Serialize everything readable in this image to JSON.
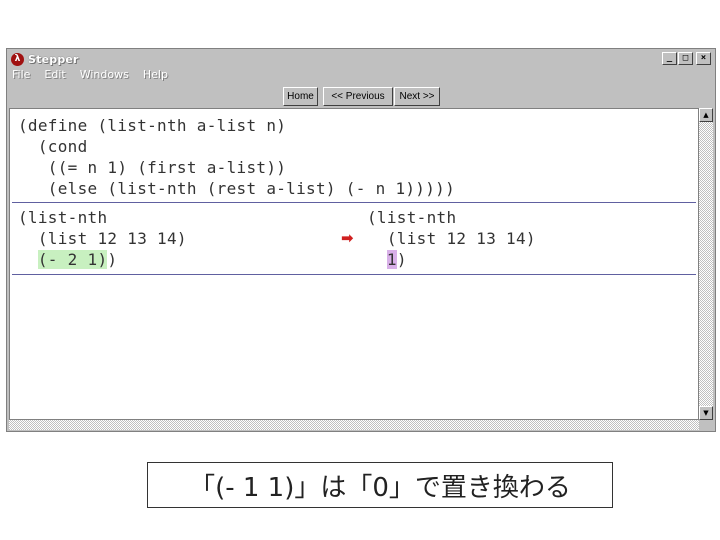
{
  "window": {
    "title": "Stepper",
    "app_icon_glyph": "λ",
    "controls": {
      "minimize": "_",
      "maximize": "□",
      "close": "×"
    }
  },
  "menu": [
    "File",
    "Edit",
    "Windows",
    "Help"
  ],
  "toolbar": {
    "home_label": "Home",
    "previous_label": "<< Previous",
    "next_label": "Next >>"
  },
  "definition": {
    "line1": "(define (list-nth a-list n)",
    "line2": "  (cond",
    "line3": "   ((= n 1) (first a-list))",
    "line4": "   (else (list-nth (rest a-list) (- n 1)))))"
  },
  "before": {
    "line1": "(list-nth",
    "line2": "  (list 12 13 14)",
    "line3_prefix": "  ",
    "line3_highlight": "(- 2 1)",
    "line3_suffix": ")"
  },
  "after": {
    "line1": "(list-nth",
    "line2": "  (list 12 13 14)",
    "line3_prefix": "  ",
    "line3_highlight": "1",
    "line3_suffix": ")"
  },
  "step_arrow": "➡",
  "caption": "「(- 1 1)」は「0」で置き換わる",
  "colors": {
    "reduce_highlight": "#c8f0c0",
    "result_highlight": "#d8b0e8",
    "arrow": "#d02020"
  }
}
